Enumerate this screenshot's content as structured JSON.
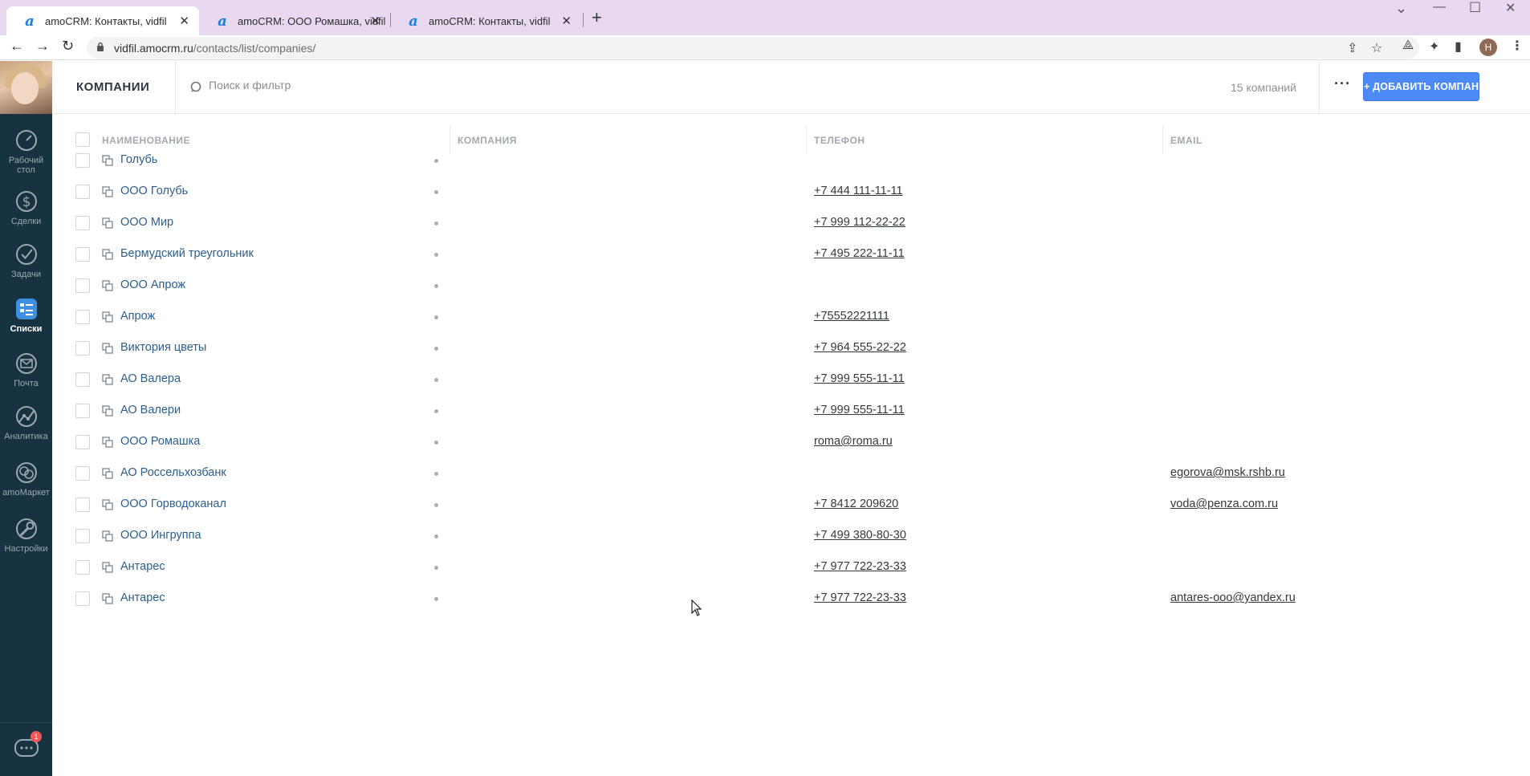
{
  "browser": {
    "tabs": [
      {
        "title": "amoCRM: Контакты, vidfil",
        "active": true
      },
      {
        "title": "amoCRM: ООО Ромашка, vidfil",
        "active": false
      },
      {
        "title": "amoCRM: Контакты, vidfil",
        "active": false
      }
    ],
    "url_host": "vidfil.amocrm.ru",
    "url_path": "/contacts/list/companies/",
    "profile_initial": "Н"
  },
  "sidebar": {
    "items": [
      {
        "label": "Рабочий стол",
        "icon": "dashboard-icon"
      },
      {
        "label": "Сделки",
        "icon": "dollar-icon"
      },
      {
        "label": "Задачи",
        "icon": "check-icon"
      },
      {
        "label": "Списки",
        "icon": "lists-icon",
        "active": true
      },
      {
        "label": "Почта",
        "icon": "mail-icon"
      },
      {
        "label": "Аналитика",
        "icon": "analytics-icon"
      },
      {
        "label": "amoМаркет",
        "icon": "market-icon"
      },
      {
        "label": "Настройки",
        "icon": "wrench-icon"
      }
    ],
    "chat_badge": "1"
  },
  "header": {
    "title": "КОМПАНИИ",
    "search_placeholder": "Поиск и фильтр",
    "count": "15 компаний",
    "more": "···",
    "add_button": "+ ДОБАВИТЬ КОМПАНИЮ"
  },
  "table": {
    "columns": [
      "НАИМЕНОВАНИЕ",
      "КОМПАНИЯ",
      "ТЕЛЕФОН",
      "EMAIL"
    ],
    "rows": [
      {
        "name": "Голубь",
        "phone": "",
        "email": ""
      },
      {
        "name": "ООО Голубь",
        "phone": "+7 444 111-11-11",
        "email": ""
      },
      {
        "name": "ООО Мир",
        "phone": "+7 999 112-22-22",
        "email": ""
      },
      {
        "name": "Бермудский треугольник",
        "phone": "+7 495 222-11-11",
        "email": ""
      },
      {
        "name": "ООО Апрож",
        "phone": "",
        "email": ""
      },
      {
        "name": "Апрож",
        "phone": "+75552221111",
        "email": ""
      },
      {
        "name": "Виктория цветы",
        "phone": "+7 964 555-22-22",
        "email": ""
      },
      {
        "name": "АО Валера",
        "phone": "+7 999 555-11-11",
        "email": ""
      },
      {
        "name": "АО Валери",
        "phone": "+7 999 555-11-11",
        "email": ""
      },
      {
        "name": "ООО Ромашка",
        "phone": "roma@roma.ru",
        "email": ""
      },
      {
        "name": "АО Россельхозбанк",
        "phone": "",
        "email": "egorova@msk.rshb.ru"
      },
      {
        "name": "ООО Горводоканал",
        "phone": "+7 8412 209620",
        "email": "voda@penza.com.ru"
      },
      {
        "name": "ООО Ингруппа",
        "phone": "+7 499 380-80-30",
        "email": ""
      },
      {
        "name": "Антарес",
        "phone": "+7 977 722-23-33",
        "email": ""
      },
      {
        "name": "Антарес",
        "phone": "+7 977 722-23-33",
        "email": "antares-ooo@yandex.ru"
      }
    ]
  },
  "colors": {
    "accent": "#4c8bf5",
    "sidebar": "#173241",
    "link": "#2b5e8c"
  }
}
